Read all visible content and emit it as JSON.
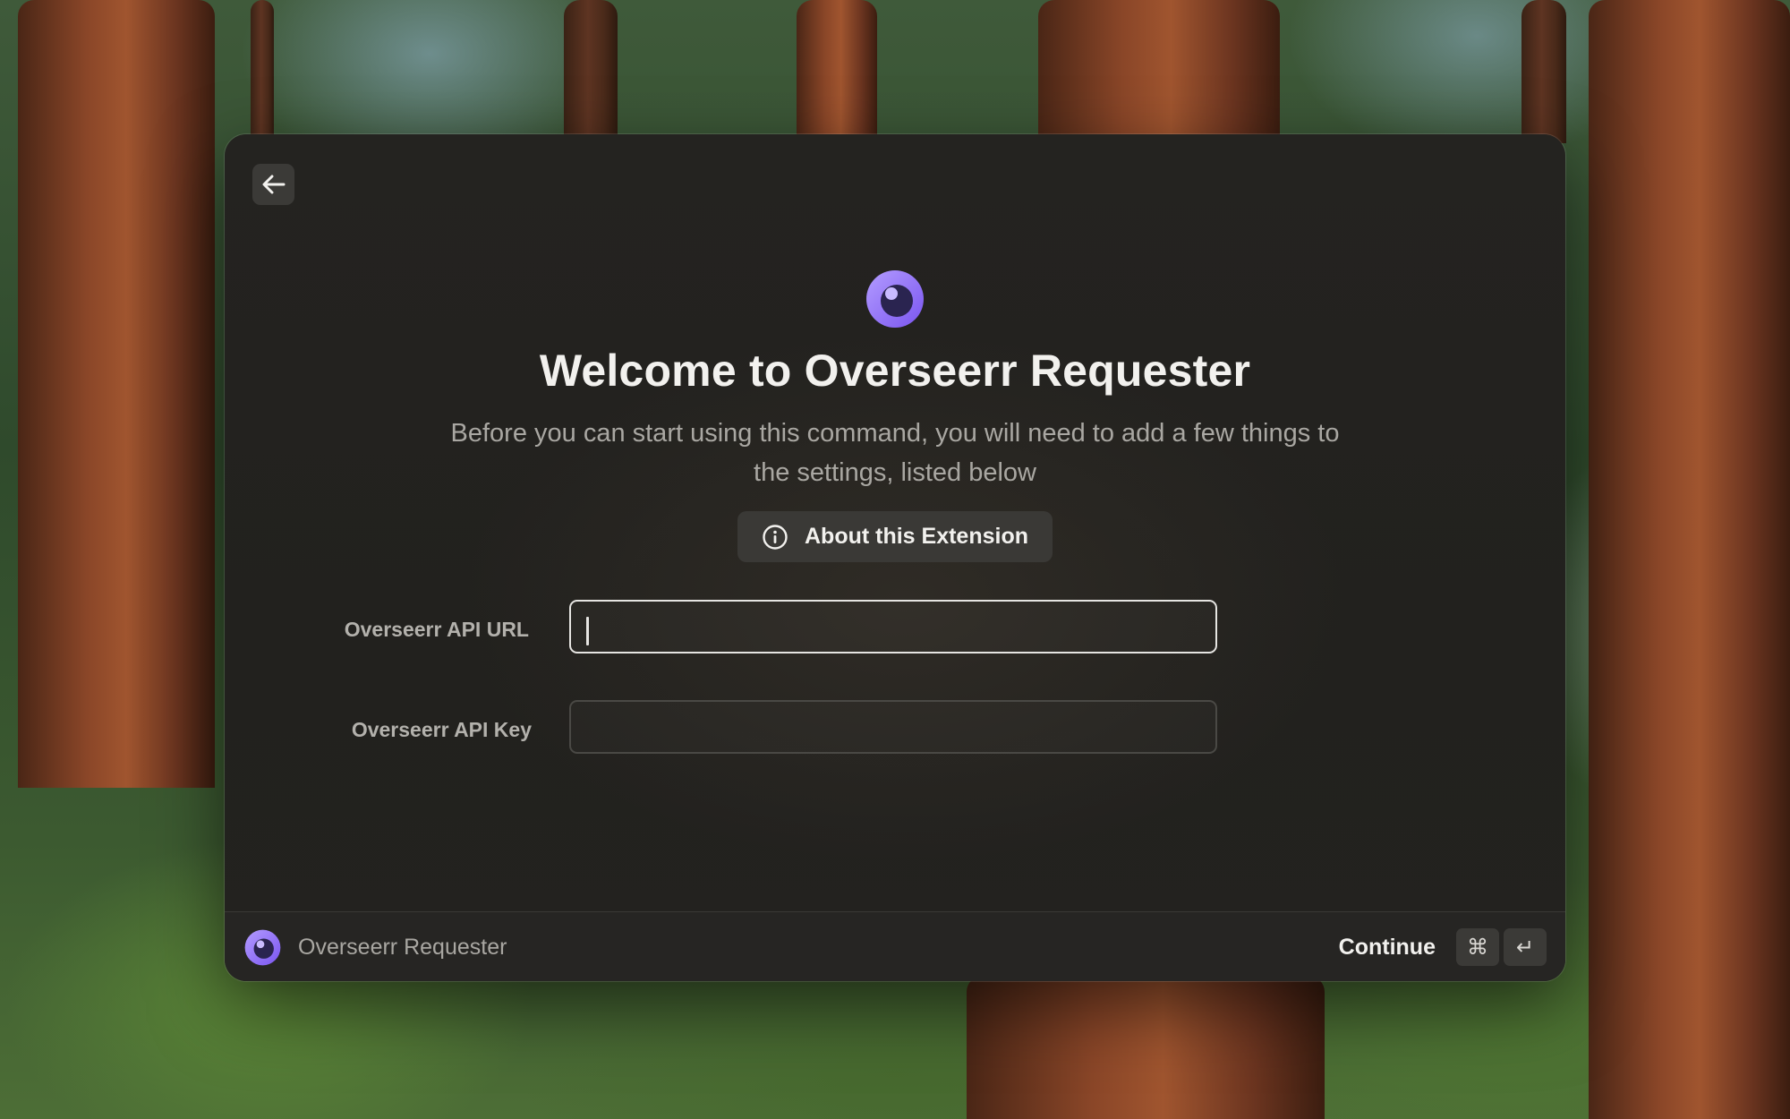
{
  "window": {
    "back_icon": "arrow-left-icon",
    "logo_icon": "overseerr-logo-icon",
    "title": "Welcome to Overseerr Requester",
    "subtitle": "Before you can start using this command, you will need to add a few things to the settings, listed below",
    "about_button": {
      "icon": "info-circle-icon",
      "label": "About this Extension"
    },
    "fields": [
      {
        "label": "Overseerr API URL",
        "value": "",
        "focused": true
      },
      {
        "label": "Overseerr API Key",
        "value": "",
        "focused": false
      }
    ]
  },
  "footer": {
    "extension_name": "Overseerr Requester",
    "action_label": "Continue",
    "shortcut_keys": [
      "⌘",
      "↵"
    ]
  },
  "colors": {
    "accent_purple": "#8b6cf6",
    "window_bg": "#242320",
    "text_primary": "#f2f1ee",
    "text_secondary": "#a9a7a2"
  }
}
